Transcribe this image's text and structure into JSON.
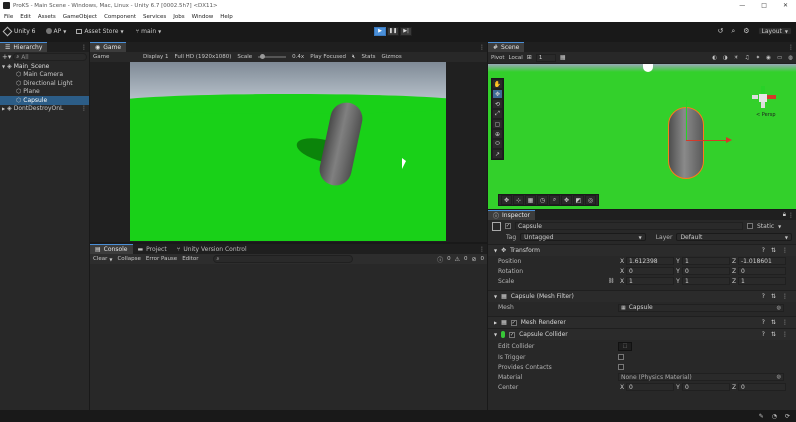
{
  "title_bar": {
    "title": "ProKS - Main Scene - Windows, Mac, Linux - Unity 6.7 [0002.5h7] <DX11>",
    "minimize": "—",
    "maximize": "□",
    "close": "✕"
  },
  "menu": [
    "File",
    "Edit",
    "Assets",
    "GameObject",
    "Component",
    "Services",
    "Jobs",
    "Window",
    "Help"
  ],
  "toolbar": {
    "unity_label": "Unity 6",
    "account_label": "AP",
    "asset_store_label": "Asset Store",
    "branch_label": "main",
    "play": "▶",
    "pause": "❚❚",
    "step": "▶|",
    "layout_label": "Layout"
  },
  "hierarchy": {
    "tab_label": "Hierarchy",
    "search_placeholder": "All",
    "items": [
      {
        "label": "Main_Scene",
        "depth": 0,
        "selected": false,
        "expanded": true
      },
      {
        "label": "Main Camera",
        "depth": 1,
        "selected": false
      },
      {
        "label": "Directional Light",
        "depth": 1,
        "selected": false
      },
      {
        "label": "Plane",
        "depth": 1,
        "selected": false
      },
      {
        "label": "Capsule",
        "depth": 1,
        "selected": true
      },
      {
        "label": "DontDestroyOnL",
        "depth": 0,
        "selected": false,
        "expanded": false
      }
    ]
  },
  "game_view": {
    "tab_label": "Game",
    "mode": "Game",
    "display": "Display 1",
    "resolution": "Full HD (1920x1080)",
    "scale_label": "Scale",
    "scale_value": "0.4x",
    "play_focused": "Play Focused",
    "stats": "Stats",
    "gizmos": "Gizmos"
  },
  "console": {
    "tabs": [
      "Console",
      "Project",
      "Unity Version Control"
    ],
    "clear": "Clear",
    "collapse": "Collapse",
    "error_pause": "Error Pause",
    "editor": "Editor",
    "count_log": "0",
    "count_warn": "0",
    "count_err": "0"
  },
  "scene_view": {
    "tab_label": "Scene",
    "pivot": "Pivot",
    "local": "Local",
    "grid_value": "1",
    "persp_label": "< Persp",
    "tools": [
      "✋",
      "✥",
      "⟲",
      "⤢",
      "▢",
      "⊕",
      "⬭",
      "↗"
    ],
    "bottom_tools": [
      "✥",
      "⊹",
      "▦",
      "◷",
      "⌕",
      "✥",
      "◩",
      "◎"
    ]
  },
  "inspector": {
    "tab_label": "Inspector",
    "object_name": "Capsule",
    "static_label": "Static",
    "tag_label": "Tag",
    "tag_value": "Untagged",
    "layer_label": "Layer",
    "layer_value": "Default",
    "transform": {
      "header": "Transform",
      "position_label": "Position",
      "rotation_label": "Rotation",
      "scale_label": "Scale",
      "position": {
        "x": "1.612398",
        "y": "1",
        "z": "-1.018601"
      },
      "rotation": {
        "x": "0",
        "y": "0",
        "z": "0"
      },
      "scale": {
        "x": "1",
        "y": "1",
        "z": "1"
      }
    },
    "mesh_filter": {
      "header": "Capsule (Mesh Filter)",
      "mesh_label": "Mesh",
      "mesh_value": "Capsule"
    },
    "mesh_renderer": {
      "header": "Mesh Renderer"
    },
    "capsule_collider": {
      "header": "Capsule Collider",
      "edit_collider_label": "Edit Collider",
      "is_trigger_label": "Is Trigger",
      "provides_contacts_label": "Provides Contacts",
      "material_label": "Material",
      "material_value": "None (Physics Material)",
      "center_label": "Center",
      "center": {
        "x": "0",
        "y": "0",
        "z": "0"
      }
    }
  },
  "colors": {
    "accent": "#4a8fd8",
    "ground_green": "#19d118",
    "sky_top": "#a0aebe",
    "capsule_outline": "#ff7a1a",
    "panel_bg": "#282828",
    "toolbar_bg": "#191919"
  }
}
